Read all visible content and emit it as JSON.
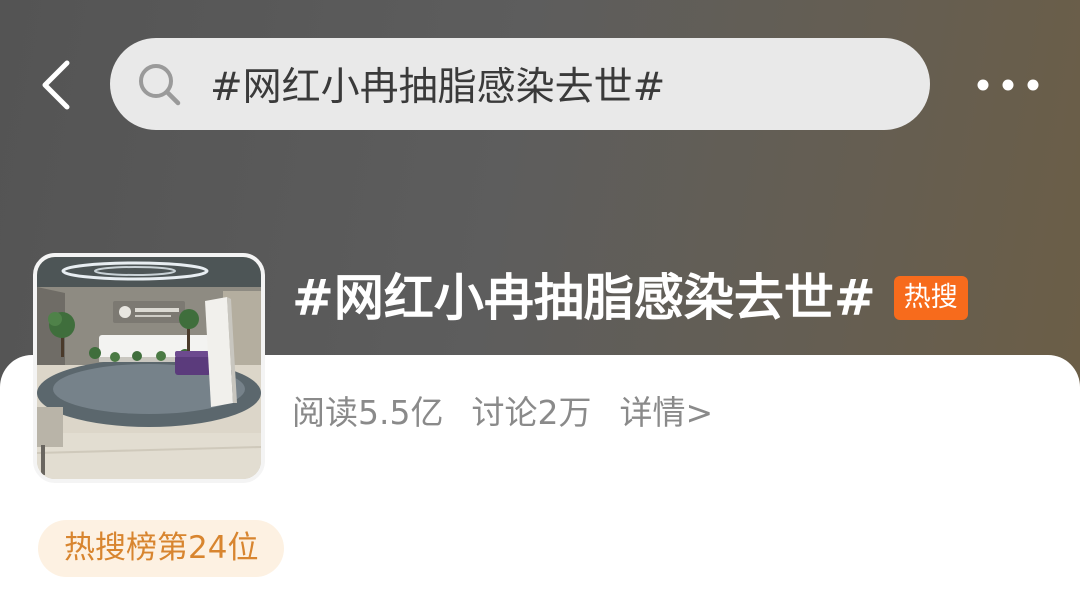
{
  "header": {
    "back_icon": "chevron-left-icon",
    "search": {
      "icon": "search-icon",
      "query": "#网红小冉抽脂感染去世#"
    },
    "more_icon": "more-dots-icon"
  },
  "topic": {
    "title": "#网红小冉抽脂感染去世#",
    "badge": "热搜",
    "stats": {
      "reads": "阅读5.5亿",
      "discussions": "讨论2万",
      "details": "详情>"
    },
    "rank_tag": "热搜榜第24位"
  },
  "colors": {
    "hot_badge": "#f76b1c",
    "rank_tag_text": "#d8852f",
    "rank_tag_bg": "#fdf1e2",
    "stats_text": "#8a8a8a"
  }
}
